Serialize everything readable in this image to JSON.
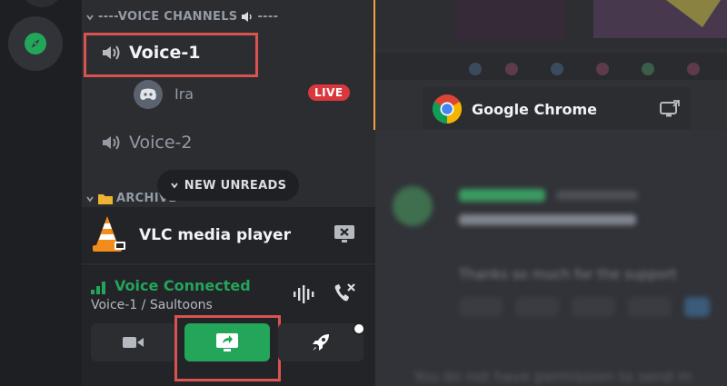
{
  "sidebar": {
    "category_voice": "----VOICE CHANNELS",
    "category_voice_suffix": "----",
    "voice_channels": [
      {
        "name": "Voice-1"
      },
      {
        "name": "Voice-2"
      }
    ],
    "voice_users": [
      {
        "name": "Ira",
        "badge": "LIVE"
      }
    ],
    "new_unreads": "NEW UNREADS",
    "category_archive": "ARCHIVE"
  },
  "stream_source": {
    "app_name": "VLC media player"
  },
  "voice_panel": {
    "status": "Voice Connected",
    "channel_path": "Voice-1 / Saultoons"
  },
  "stream_view": {
    "source_name": "Google Chrome"
  },
  "chat": {
    "blurred_message": "Thanks so much for the support",
    "permission_text": "You do not have permission to send m"
  },
  "colors": {
    "connected_green": "#23a55a",
    "live_red": "#da373c",
    "highlight_red": "#d9534f",
    "stream_border_orange": "#f0a33a"
  }
}
